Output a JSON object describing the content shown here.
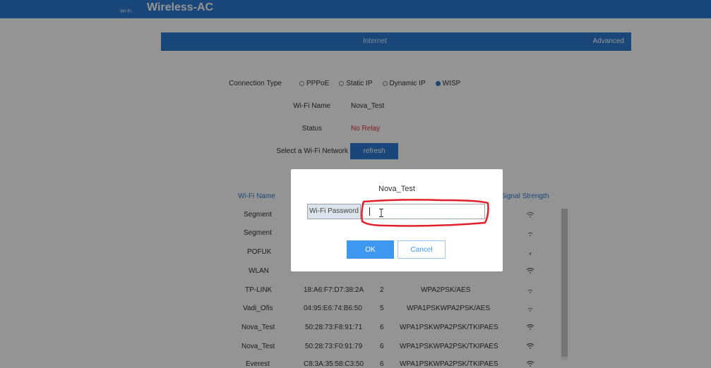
{
  "header": {
    "logo_small": "Wi-Fi",
    "brand": "Wireless-AC"
  },
  "tabs": {
    "internet": "Internet",
    "advanced": "Advanced"
  },
  "form": {
    "connection_type_label": "Connection Type",
    "options": [
      "PPPoE",
      "Static IP",
      "Dynamic IP",
      "WISP"
    ],
    "selected_option": "WISP",
    "wifi_name_label": "Wi-Fi Name",
    "wifi_name_value": "Nova_Test",
    "status_label": "Status",
    "status_value": "No Relay",
    "select_label": "Select a Wi-Fi Network",
    "refresh_label": "refresh"
  },
  "table": {
    "headers": {
      "wifi_name": "Wi-Fi Name",
      "signal_strength": "Signal Strength"
    },
    "rows": [
      {
        "name": "Segment",
        "mac": "",
        "channel": "",
        "security": ""
      },
      {
        "name": "Segment",
        "mac": "",
        "channel": "",
        "security": ""
      },
      {
        "name": "POFUK",
        "mac": "",
        "channel": "",
        "security": ""
      },
      {
        "name": "WLAN",
        "mac": "",
        "channel": "",
        "security": ""
      },
      {
        "name": "TP-LINK",
        "mac": "18:A6:F7:D7:38:2A",
        "channel": "2",
        "security": "WPA2PSK/AES"
      },
      {
        "name": "Vadi_Ofis",
        "mac": "04:95:E6:74:B6:50",
        "channel": "5",
        "security": "WPA1PSKWPA2PSK/AES"
      },
      {
        "name": "Nova_Test",
        "mac": "50:28:73:F8:91:71",
        "channel": "6",
        "security": "WPA1PSKWPA2PSK/TKIPAES"
      },
      {
        "name": "Nova_Test",
        "mac": "50:28:73:F0:91:79",
        "channel": "6",
        "security": "WPA1PSKWPA2PSK/TKIPAES"
      },
      {
        "name": "Everest",
        "mac": "C8:3A:35:58:C3:50",
        "channel": "6",
        "security": "WPA1PSKWPA2PSK/TKIPAES"
      }
    ]
  },
  "dialog": {
    "title": "Nova_Test",
    "password_label": "Wi-Fi Password",
    "password_value": "",
    "ok_label": "OK",
    "cancel_label": "Cancel"
  },
  "colors": {
    "brand_blue": "#2b7bd0",
    "status_red": "#e0303a",
    "annotation_red": "#e2202a"
  },
  "icons": {
    "signal": "wifi-signal-icon",
    "text_cursor": "text-cursor-icon"
  }
}
